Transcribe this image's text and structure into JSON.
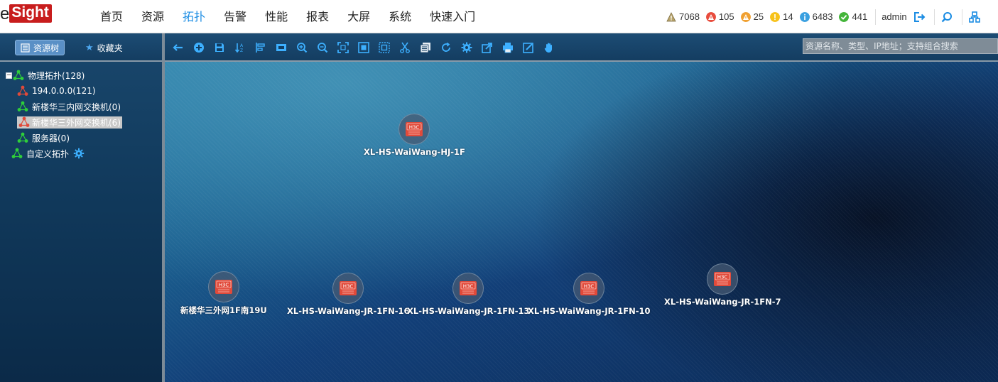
{
  "app": {
    "logo_prefix": "e",
    "logo_main": "Sight"
  },
  "nav": {
    "items": [
      "首页",
      "资源",
      "拓扑",
      "告警",
      "性能",
      "报表",
      "大屏",
      "系统",
      "快速入门"
    ],
    "active_index": 2
  },
  "alarms": [
    {
      "icon": "critical-alarm-icon",
      "value": "7068",
      "color": "#b8a36a"
    },
    {
      "icon": "major-alarm-icon",
      "value": "105",
      "color": "#e84c3d"
    },
    {
      "icon": "minor-alarm-icon",
      "value": "25",
      "color": "#f0a030"
    },
    {
      "icon": "warning-alarm-icon",
      "value": "14",
      "color": "#f7c21a"
    },
    {
      "icon": "info-alarm-icon",
      "value": "6483",
      "color": "#3aa0e0"
    },
    {
      "icon": "cleared-alarm-icon",
      "value": "441",
      "color": "#44b53a"
    }
  ],
  "user": {
    "name": "admin"
  },
  "left_tabs": [
    {
      "label": "资源树",
      "icon": "resource-tree-icon",
      "active": true
    },
    {
      "label": "收藏夹",
      "icon": "star-icon",
      "active": false
    }
  ],
  "search": {
    "placeholder": "资源名称、类型、IP地址；支持组合搜索"
  },
  "tree": {
    "root": {
      "label": "物理拓扑(128)"
    },
    "children": [
      {
        "label": "194.0.0.0(121)",
        "color": "#e04a3a",
        "selected": false
      },
      {
        "label": "新楼华三内网交换机(0)",
        "color": "#2fcf3a",
        "selected": false
      },
      {
        "label": "新楼华三外网交换机(6)",
        "color": "#e04a3a",
        "selected": true
      },
      {
        "label": "服务器(0)",
        "color": "#2fcf3a",
        "selected": false
      }
    ],
    "custom": {
      "label": "自定义拓扑"
    }
  },
  "devices": [
    {
      "label": "XL-HS-WaiWang-HJ-1F",
      "vendor": "H3C"
    },
    {
      "label": "新楼华三外网1F南19U",
      "vendor": "H3C"
    },
    {
      "label": "XL-HS-WaiWang-JR-1FN-16",
      "vendor": "H3C"
    },
    {
      "label": "XL-HS-WaiWang-JR-1FN-13",
      "vendor": "H3C"
    },
    {
      "label": "XL-HS-WaiWang-JR-1FN-10",
      "vendor": "H3C"
    },
    {
      "label": "XL-HS-WaiWang-JR-1FN-7",
      "vendor": "H3C"
    }
  ],
  "colors": {
    "accent": "#1a8ce3",
    "brand_red": "#c81d1d",
    "toolbar_bg": "#1c4c74",
    "device_red": "#e14a3a"
  }
}
